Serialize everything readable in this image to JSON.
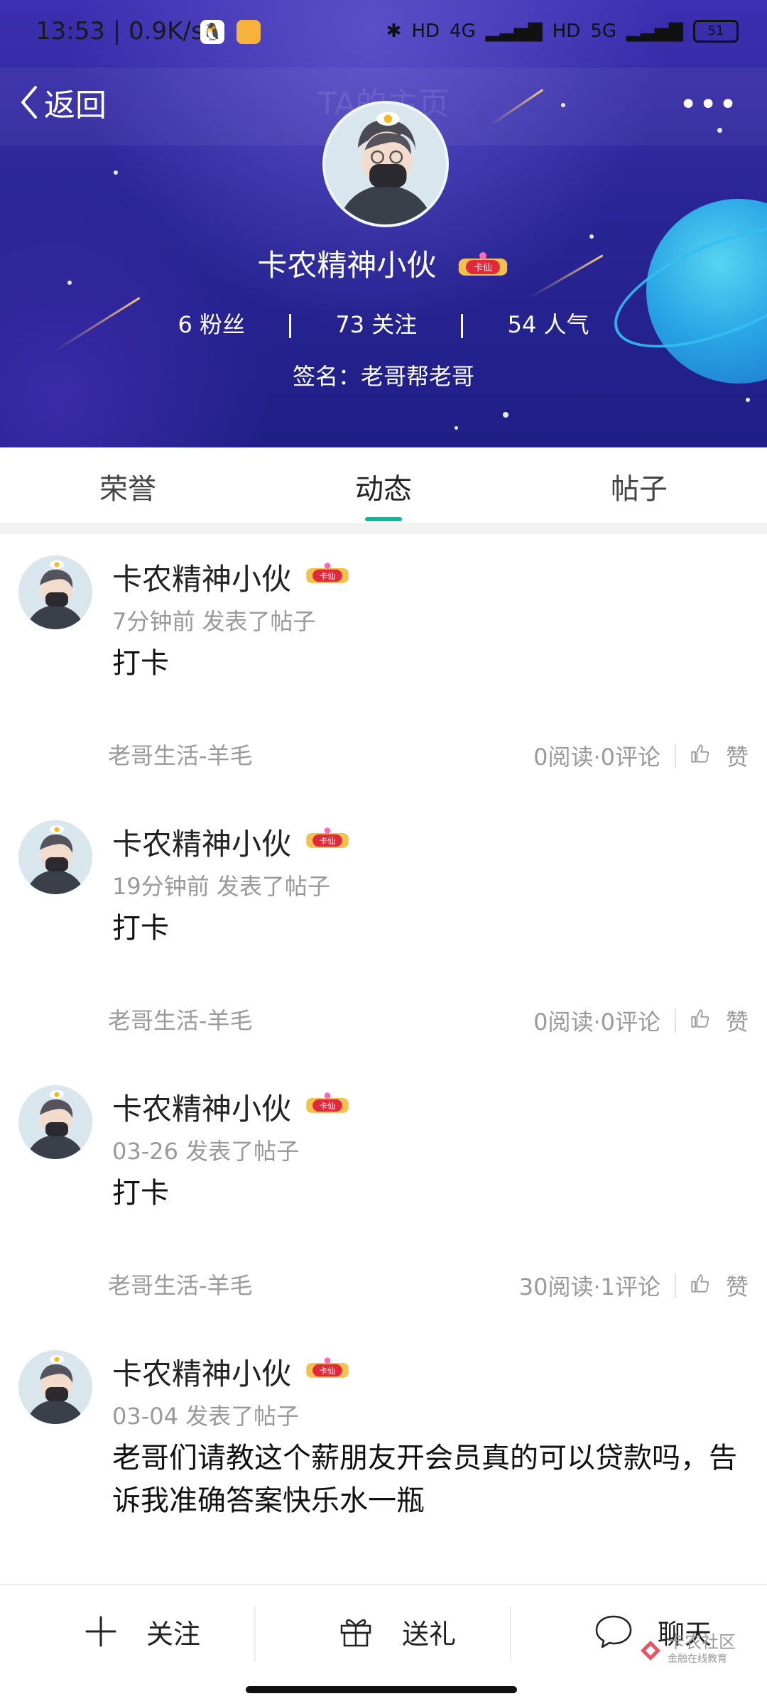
{
  "status_bar": {
    "time_speed": "13:53 | 0.9K/s",
    "network_labels": [
      "HD",
      "4G",
      "HD",
      "5G"
    ],
    "battery": "51"
  },
  "header": {
    "back_label": "返回",
    "ghost_title": "TA的主页",
    "more_label": "•••",
    "profile_name": "卡农精神小伙",
    "badge_text": "卡仙",
    "stats": {
      "fans": "6 粉丝",
      "following": "73 关注",
      "popularity": "54 人气"
    },
    "signature": "签名：老哥帮老哥"
  },
  "tabs": [
    {
      "label": "荣誉",
      "active": false
    },
    {
      "label": "动态",
      "active": true
    },
    {
      "label": "帖子",
      "active": false
    }
  ],
  "posts": [
    {
      "author": "卡农精神小伙",
      "badge_text": "卡仙",
      "time": "7分钟前",
      "action": "发表了帖子",
      "content": "打卡",
      "forum": "老哥生活-羊毛",
      "stats": "0阅读·0评论",
      "like_label": "赞"
    },
    {
      "author": "卡农精神小伙",
      "badge_text": "卡仙",
      "time": "19分钟前",
      "action": "发表了帖子",
      "content": "打卡",
      "forum": "老哥生活-羊毛",
      "stats": "0阅读·0评论",
      "like_label": "赞"
    },
    {
      "author": "卡农精神小伙",
      "badge_text": "卡仙",
      "time": "03-26",
      "action": "发表了帖子",
      "content": "打卡",
      "forum": "老哥生活-羊毛",
      "stats": "30阅读·1评论",
      "like_label": "赞"
    },
    {
      "author": "卡农精神小伙",
      "badge_text": "卡仙",
      "time": "03-04",
      "action": "发表了帖子",
      "content": "老哥们请教这个薪朋友开会员真的可以贷款吗，告诉我准确答案快乐水一瓶"
    }
  ],
  "bottom_bar": {
    "follow_label": "关注",
    "gift_label": "送礼",
    "chat_label": "聊天"
  },
  "watermark": {
    "title": "卡农社区",
    "subtitle": "金融在线教育"
  },
  "colors": {
    "accent": "#18b39c",
    "header_dark": "#1f1f86",
    "header_light": "#5a4fc8",
    "planet": "#2aa6e6"
  }
}
